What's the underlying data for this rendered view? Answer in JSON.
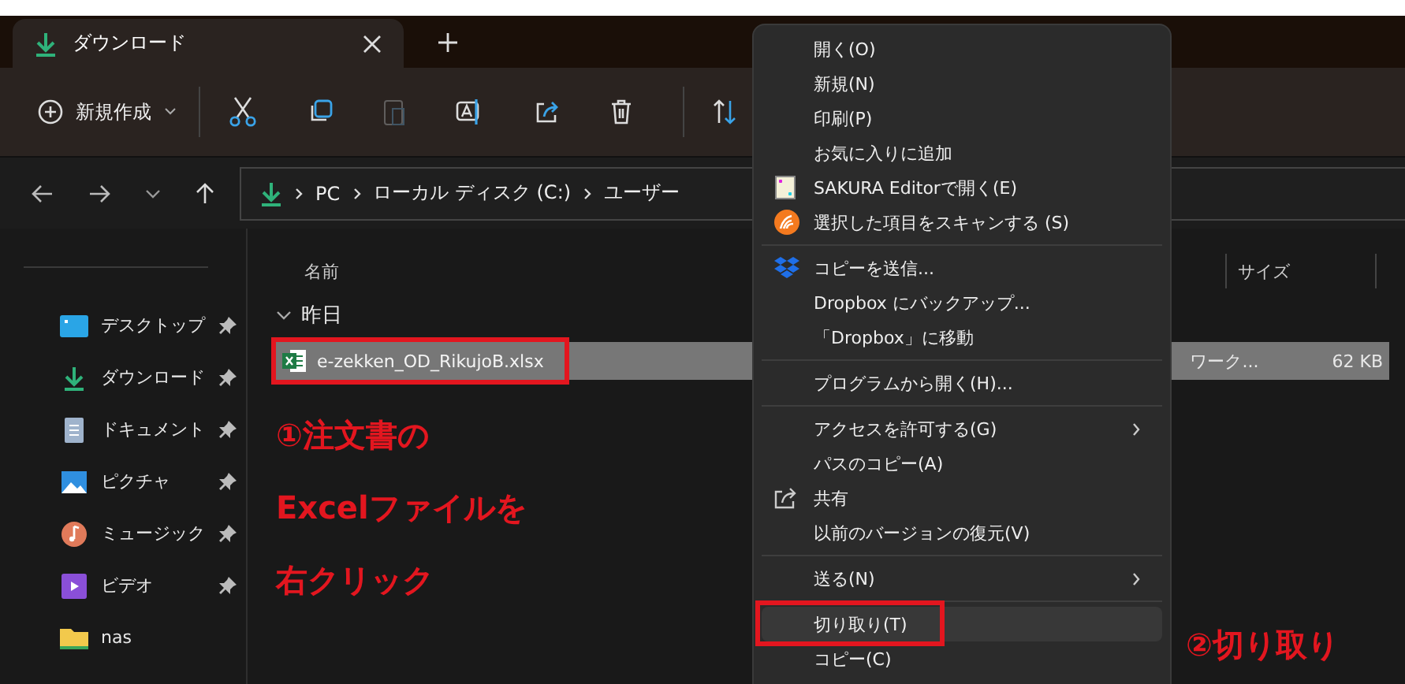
{
  "tabs": [
    {
      "label": "ダウンロード",
      "selected": true
    }
  ],
  "toolbar": {
    "new_button": "新規作成"
  },
  "address_bar": {
    "path": [
      "PC",
      "ローカル ディスク (C:)",
      "ユーザー"
    ]
  },
  "sidebar": {
    "items": [
      {
        "kind": "desktop",
        "label": "デスクトップ",
        "pinned": true
      },
      {
        "kind": "download",
        "label": "ダウンロード",
        "pinned": true
      },
      {
        "kind": "documents",
        "label": "ドキュメント",
        "pinned": true
      },
      {
        "kind": "pictures",
        "label": "ピクチャ",
        "pinned": true
      },
      {
        "kind": "music",
        "label": "ミュージック",
        "pinned": true
      },
      {
        "kind": "videos",
        "label": "ビデオ",
        "pinned": true
      },
      {
        "kind": "folder",
        "label": "nas",
        "pinned": false
      }
    ]
  },
  "columns": [
    "名前",
    "サイズ"
  ],
  "groups": [
    {
      "label": "昨日",
      "expanded": true,
      "files": [
        {
          "name": "e-zekken_OD_RikujoB.xlsx",
          "type": "ワーク...",
          "size": "62 KB",
          "selected": true,
          "framed": true
        }
      ]
    }
  ],
  "context_menu": {
    "items": [
      {
        "kind": "plain",
        "label": "開く(O)",
        "hovered": false,
        "framed": false
      },
      {
        "kind": "plain",
        "label": "新規(N)",
        "hovered": false,
        "framed": false
      },
      {
        "kind": "plain",
        "label": "印刷(P)",
        "hovered": false,
        "framed": false
      },
      {
        "kind": "plain",
        "label": "お気に入りに追加",
        "hovered": false,
        "framed": false
      },
      {
        "kind": "editor",
        "label": "SAKURA Editorで開く(E)",
        "hovered": false,
        "framed": false
      },
      {
        "kind": "scan",
        "label": "選択した項目をスキャンする (S)",
        "hovered": false,
        "framed": false
      },
      {
        "kind": "separator"
      },
      {
        "kind": "dropbox",
        "label": "コピーを送信...",
        "hovered": false,
        "framed": false
      },
      {
        "kind": "plain",
        "label": "Dropbox にバックアップ...",
        "hovered": false,
        "framed": false
      },
      {
        "kind": "plain",
        "label": "「Dropbox」に移動",
        "hovered": false,
        "framed": false
      },
      {
        "kind": "separator"
      },
      {
        "kind": "plain",
        "label": "プログラムから開く(H)...",
        "hovered": false,
        "framed": false
      },
      {
        "kind": "separator"
      },
      {
        "kind": "submenu",
        "label": "アクセスを許可する(G)",
        "hovered": false,
        "framed": false
      },
      {
        "kind": "plain",
        "label": "パスのコピー(A)",
        "hovered": false,
        "framed": false
      },
      {
        "kind": "share",
        "label": "共有",
        "hovered": false,
        "framed": false
      },
      {
        "kind": "plain",
        "label": "以前のバージョンの復元(V)",
        "hovered": false,
        "framed": false
      },
      {
        "kind": "separator"
      },
      {
        "kind": "submenu",
        "label": "送る(N)",
        "hovered": false,
        "framed": false
      },
      {
        "kind": "separator"
      },
      {
        "kind": "plain",
        "label": "切り取り(T)",
        "hovered": true,
        "framed": true
      },
      {
        "kind": "plain",
        "label": "コピー(C)",
        "hovered": false,
        "framed": false
      }
    ]
  },
  "annotations": [
    {
      "lines": [
        "①注文書の",
        "Excelファイルを",
        "右クリック"
      ]
    },
    {
      "lines": [
        "②切り取り"
      ]
    }
  ]
}
